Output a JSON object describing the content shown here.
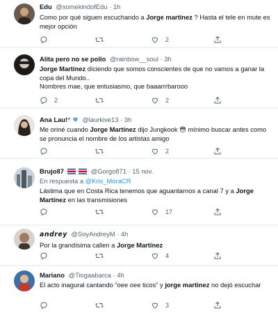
{
  "tweets": [
    {
      "name": "Edu",
      "handle": "@somekindofEdu",
      "time": "1h",
      "text_parts": [
        "Como por qué siguen escuchando a ",
        "Jorge martínez",
        " ? Hasta el tele en mute es mejor opción"
      ],
      "replies": "",
      "retweets": "",
      "likes": "2"
    },
    {
      "name": "Alita pero no se pollo",
      "handle": "@rainbow__soul",
      "time": "3h",
      "text_parts": [
        "Jorge Martínez",
        " diciendo que somos conscientes de que no vamos a ganar la copa del Mundo..",
        "Nombres mae, que entusiasmo, que baaarrrbarooo"
      ],
      "replies": "2",
      "retweets": "",
      "likes": "2"
    },
    {
      "name": "Ana Lau!⁷",
      "handle": "@laurkive13",
      "time": "3h",
      "text_parts": [
        "Me oriné cuando ",
        "Jorge Martínez",
        " dijo Jungkook 😳 mínimo buscar antes como se pronuncia el nombre de los artistas amigo"
      ],
      "replies": "",
      "retweets": "",
      "likes": "2"
    },
    {
      "name": "Brujo87",
      "handle": "@Gorgo871",
      "time": "15 nov.",
      "reply_prefix": "En respuesta a",
      "reply_to": "@Kris_MoraCR",
      "text_parts": [
        "Lástima que en Costa Rica tenemos que aguantarnos a canal 7 y a ",
        "Jorge Martínez",
        " en las transmisiones"
      ],
      "replies": "",
      "retweets": "",
      "likes": "17"
    },
    {
      "name": "𝙖𝙣𝙙𝙧𝙚𝙮",
      "handle": "@SoyAndreyM",
      "time": "4h",
      "text_parts": [
        "Por la grandísima callen a ",
        "Jorge Martínez"
      ],
      "replies": "",
      "retweets": "",
      "likes": "4"
    },
    {
      "name": "Mariano",
      "handle": "@Tiogaabarca",
      "time": "4h",
      "text_parts": [
        "El acto inagural cantando “oee oee ticos” y ",
        "jorge martinez",
        " no dejó escuchar"
      ],
      "replies": "",
      "retweets": "",
      "likes": "3"
    }
  ],
  "colors": {
    "text": "#0f1419",
    "muted": "#536471",
    "link": "#1d9bf0",
    "divider": "#eff3f4"
  }
}
